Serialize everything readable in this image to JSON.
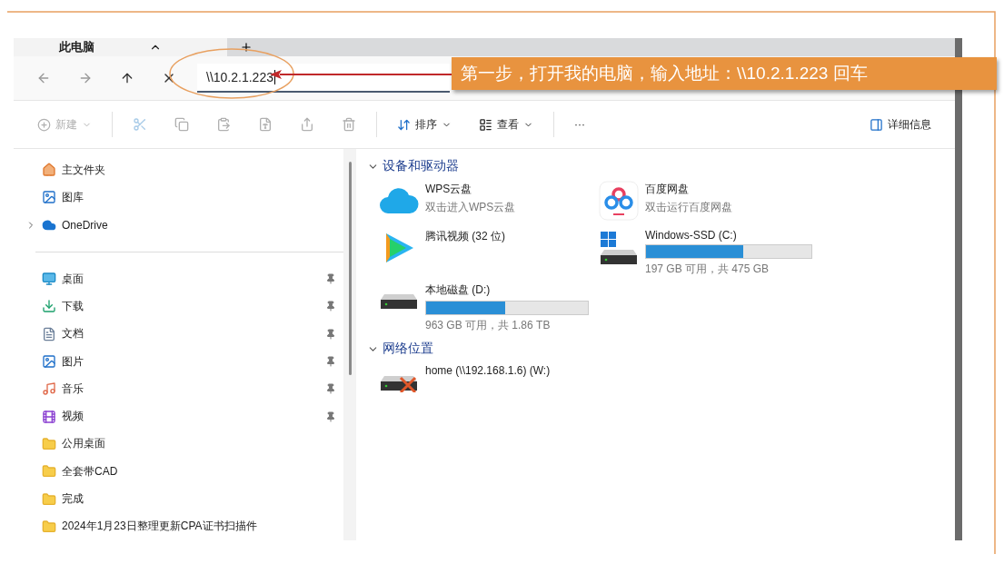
{
  "window": {
    "tab_title": "此电脑"
  },
  "address": {
    "value": "\\\\10.2.1.223"
  },
  "toolbar": {
    "items": [
      {
        "kind": "new",
        "label": "新建",
        "disabled": true
      },
      {
        "kind": "cut",
        "disabled": true
      },
      {
        "kind": "copy",
        "disabled": true
      },
      {
        "kind": "paste",
        "disabled": true
      },
      {
        "kind": "rename",
        "disabled": true
      },
      {
        "kind": "share",
        "disabled": true
      },
      {
        "kind": "delete",
        "disabled": true
      },
      {
        "kind": "sort",
        "label": "排序",
        "disabled": false
      },
      {
        "kind": "view",
        "label": "查看",
        "disabled": false
      },
      {
        "kind": "more",
        "label": "···",
        "disabled": false
      }
    ],
    "details": "详细信息"
  },
  "sidebar": {
    "groups": [
      [
        {
          "kind": "home",
          "label": "主文件夹",
          "pinned": false,
          "expandable": false
        },
        {
          "kind": "gallery",
          "label": "图库",
          "pinned": false,
          "expandable": false
        },
        {
          "kind": "cloud",
          "label": "OneDrive",
          "pinned": false,
          "expandable": true
        }
      ],
      [
        {
          "kind": "desktop",
          "label": "桌面",
          "pinned": true,
          "expandable": false
        },
        {
          "kind": "download",
          "label": "下载",
          "pinned": true,
          "expandable": false
        },
        {
          "kind": "document",
          "label": "文档",
          "pinned": true,
          "expandable": false
        },
        {
          "kind": "picture",
          "label": "图片",
          "pinned": true,
          "expandable": false
        },
        {
          "kind": "music",
          "label": "音乐",
          "pinned": true,
          "expandable": false
        },
        {
          "kind": "video",
          "label": "视频",
          "pinned": true,
          "expandable": false
        },
        {
          "kind": "folder",
          "label": "公用桌面",
          "pinned": false,
          "expandable": false
        },
        {
          "kind": "folder",
          "label": "全套带CAD",
          "pinned": false,
          "expandable": false
        },
        {
          "kind": "folder",
          "label": "完成",
          "pinned": false,
          "expandable": false
        },
        {
          "kind": "folder",
          "label": "2024年1月23日整理更新CPA证书扫描件",
          "pinned": false,
          "expandable": false
        }
      ]
    ]
  },
  "sections": [
    {
      "title": "设备和驱动器",
      "expanded": true,
      "items": [
        {
          "kind": "wps",
          "name": "WPS云盘",
          "subtitle": "双击进入WPS云盘"
        },
        {
          "kind": "baidu",
          "name": "百度网盘",
          "subtitle": "双击运行百度网盘"
        },
        {
          "kind": "tencent",
          "name": "腾讯视频 (32 位)"
        },
        {
          "kind": "system-drive",
          "name": "Windows-SSD (C:)",
          "level": 0.59,
          "reading": "197 GB 可用，共 475 GB"
        },
        {
          "kind": "drive",
          "name": "本地磁盘 (D:)",
          "level": 0.49,
          "reading": "963 GB 可用，共 1.86 TB"
        }
      ]
    },
    {
      "title": "网络位置",
      "expanded": true,
      "items": [
        {
          "kind": "network-drive",
          "name": "home (\\\\192.168.1.6) (W:)"
        }
      ]
    }
  ],
  "annotation": {
    "text": "第一步，打开我的电脑，输入地址：\\\\10.2.1.223 回车"
  }
}
